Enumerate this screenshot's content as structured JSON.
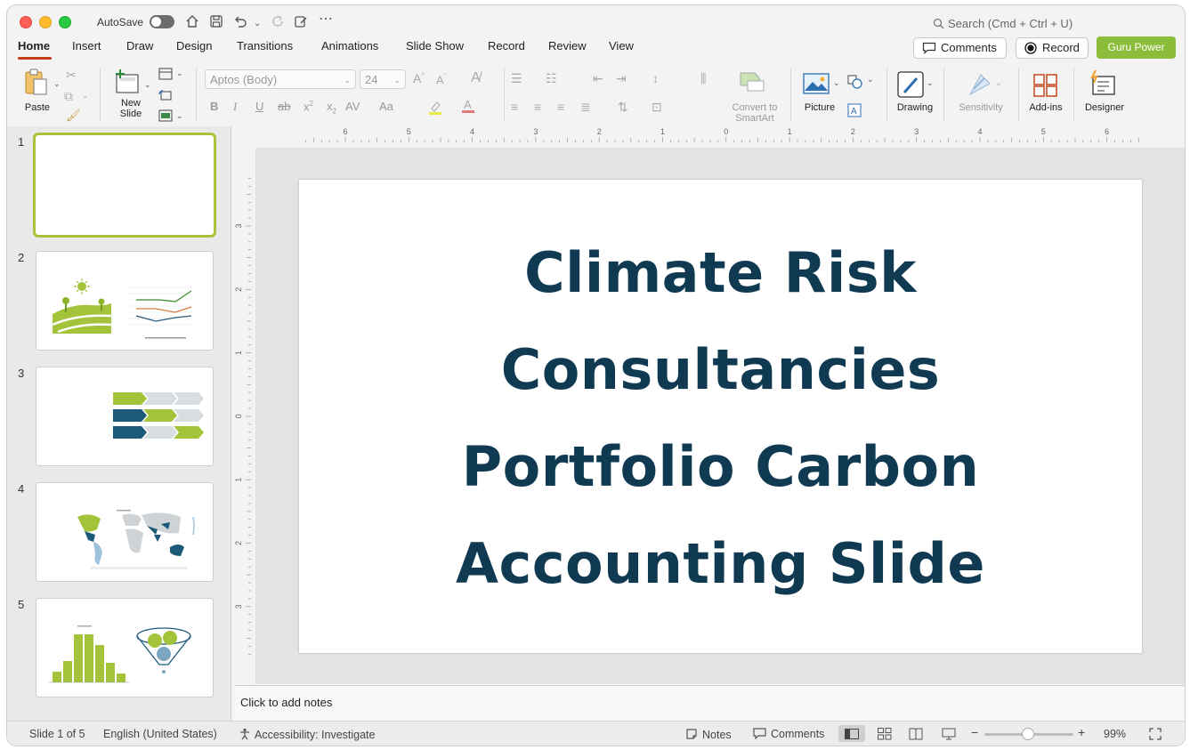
{
  "titlebar": {
    "autosave_label": "AutoSave",
    "search_placeholder": "Search (Cmd + Ctrl + U)"
  },
  "tabs": [
    "Home",
    "Insert",
    "Draw",
    "Design",
    "Transitions",
    "Animations",
    "Slide Show",
    "Record",
    "Review",
    "View"
  ],
  "header_buttons": {
    "comments": "Comments",
    "record": "Record",
    "guru": "Guru Power"
  },
  "ribbon": {
    "paste": "Paste",
    "new_slide": "New\nSlide",
    "font_name": "Aptos (Body)",
    "font_size": "24",
    "convert_smartart": "Convert to\nSmartArt",
    "picture": "Picture",
    "drawing": "Drawing",
    "sensitivity": "Sensitivity",
    "addins": "Add-ins",
    "designer": "Designer"
  },
  "thumbnails": [
    {
      "number": "1"
    },
    {
      "number": "2"
    },
    {
      "number": "3"
    },
    {
      "number": "4"
    },
    {
      "number": "5"
    }
  ],
  "rulers": {
    "top_ticks": [
      "6",
      "5",
      "4",
      "3",
      "2",
      "1",
      "0",
      "1",
      "2",
      "3",
      "4",
      "5",
      "6"
    ],
    "left_ticks": [
      "3",
      "2",
      "1",
      "0",
      "1",
      "2",
      "3"
    ]
  },
  "slide": {
    "title_lines": [
      "Climate Risk",
      "Consultancies",
      "Portfolio Carbon",
      "Accounting Slide"
    ]
  },
  "notes_placeholder": "Click to add notes",
  "status": {
    "slide_count": "Slide 1 of 5",
    "language": "English (United States)",
    "accessibility": "Accessibility: Investigate",
    "notes": "Notes",
    "comments": "Comments",
    "zoom": "99%"
  },
  "colors": {
    "accent_tab": "#c43e1c",
    "guru_green": "#8cbd3a",
    "slide_title": "#0f3a52",
    "thumb_select": "#a7c438"
  }
}
